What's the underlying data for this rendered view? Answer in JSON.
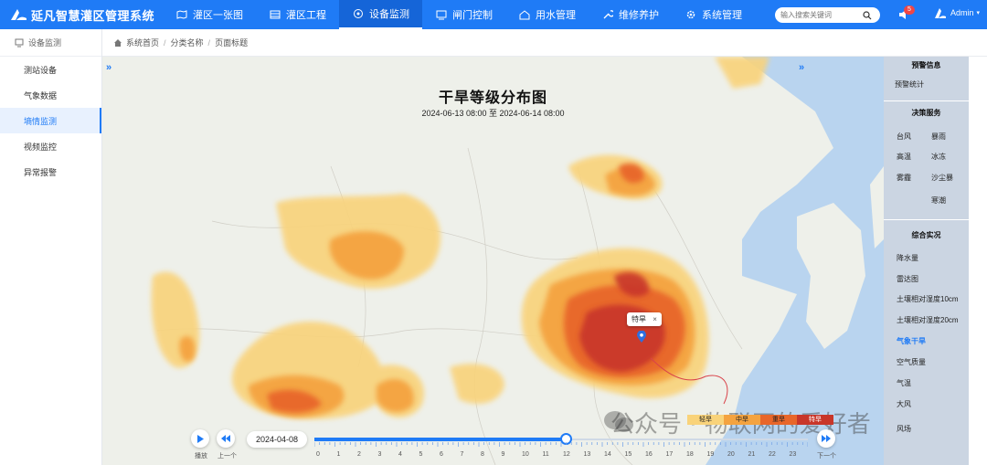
{
  "app": {
    "title": "延凡智慧灌区管理系统"
  },
  "nav": {
    "items": [
      {
        "label": "灌区一张图",
        "icon": "map-icon"
      },
      {
        "label": "灌区工程",
        "icon": "list-icon"
      },
      {
        "label": "设备监测",
        "icon": "monitor-icon",
        "active": true
      },
      {
        "label": "闸门控制",
        "icon": "gate-icon"
      },
      {
        "label": "用水管理",
        "icon": "water-icon"
      },
      {
        "label": "维修养护",
        "icon": "wrench-icon"
      },
      {
        "label": "系统管理",
        "icon": "gear-icon"
      }
    ]
  },
  "search": {
    "placeholder": "输入搜索关键词"
  },
  "notifications": {
    "count": "5"
  },
  "user": {
    "name": "Admin"
  },
  "sidebar": {
    "header": "设备监测",
    "items": [
      {
        "label": "测站设备"
      },
      {
        "label": "气象数据"
      },
      {
        "label": "墒情监测",
        "active": true
      },
      {
        "label": "视频监控"
      },
      {
        "label": "异常报警"
      }
    ]
  },
  "breadcrumb": {
    "items": [
      "系统首页",
      "分类名称",
      "页面标题"
    ]
  },
  "map": {
    "title": "干旱等级分布图",
    "range": "2024-06-13 08:00 至 2024-06-14 08:00",
    "marker_label": "特旱",
    "marker_close": "×"
  },
  "timeline": {
    "play_label": "播放",
    "prev_label": "上一个",
    "next_label": "下一个",
    "current_date": "2024-04-08",
    "hours": [
      "0",
      "1",
      "2",
      "3",
      "4",
      "5",
      "6",
      "7",
      "8",
      "9",
      "10",
      "11",
      "12",
      "13",
      "14",
      "15",
      "16",
      "17",
      "18",
      "19",
      "20",
      "21",
      "22",
      "23"
    ],
    "progress": 0.51
  },
  "legend": {
    "items": [
      {
        "label": "轻旱",
        "color": "#f9d37a"
      },
      {
        "label": "中旱",
        "color": "#f4a340"
      },
      {
        "label": "重旱",
        "color": "#e8662a"
      },
      {
        "label": "特旱",
        "color": "#c8362a"
      }
    ]
  },
  "watermark": {
    "text": "公众号 · 物联网的爱好者"
  },
  "right_panel": {
    "warning_title": "预警信息",
    "warning_items": [
      "预警统计"
    ],
    "decision_title": "决策服务",
    "decision_items": [
      "台风",
      "暴雨",
      "高温",
      "冰冻",
      "雾霾",
      "沙尘暴",
      "寒潮"
    ],
    "live_title": "综合实况",
    "live_items": [
      "降水量",
      "雷达图",
      "土壤相对湿度10cm",
      "土壤相对湿度20cm",
      "气象干旱",
      "空气质量",
      "气温",
      "大风",
      "风场"
    ],
    "live_active": "气象干旱"
  },
  "colors": {
    "brand": "#1f7bf6",
    "light": "#f9d37a",
    "medium": "#f4a340",
    "heavy": "#e8662a",
    "extreme": "#c8362a",
    "sea": "#b9d4ef"
  }
}
